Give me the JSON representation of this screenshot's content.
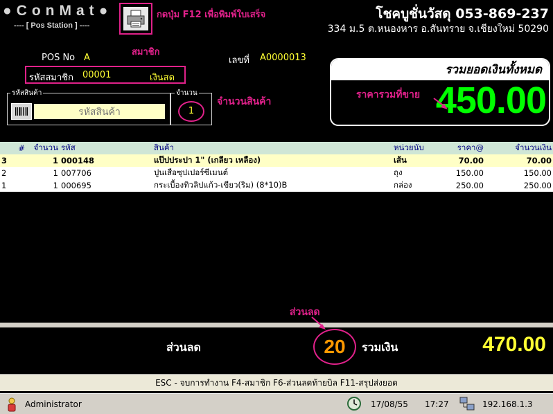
{
  "header": {
    "brand": "ConMat",
    "station": "---- [ Pos Station ] ----",
    "print_hint": "กดปุ่ม F12 เพื่อพิมพ์ใบเสร็จ",
    "shop_name": "โชคบูชั่นวัสดุ 053-869-237",
    "shop_address": "334 ม.5 ต.หนองหาร อ.สันทราย จ.เชียงใหม่ 50290"
  },
  "pos": {
    "pos_no_label": "POS No",
    "pos_no": "A",
    "doc_label": "เลขที่",
    "doc_no": "A0000013"
  },
  "member": {
    "note": "สมาชิก",
    "label": "รหัสสมาชิก",
    "code": "00001",
    "pay_type": "เงินสด"
  },
  "product": {
    "group_label": "รหัสสินค้า",
    "input_placeholder": "รหัสสินค้า",
    "qty_label": "จำนวน",
    "qty_value": "1",
    "qty_note": "จำนวนสินค้า"
  },
  "total": {
    "title": "รวมยอดเงินทั้งหมด",
    "sale_label": "ราคารวมที่ขาย",
    "amount": "450.00"
  },
  "table": {
    "headers": [
      "#",
      "จำนวน",
      "รหัส",
      "สินค้า",
      "หน่วยนับ",
      "ราคา@",
      "จำนวนเงิน"
    ],
    "rows": [
      [
        "3",
        "1",
        "000148",
        "แป๊ปประปา 1\" (เกลียว เหลือง)",
        "เส้น",
        "70.00",
        "70.00"
      ],
      [
        "2",
        "1",
        "007706",
        "ปูนเสือซุปเปอร์ซีเมนต์",
        "ถุง",
        "150.00",
        "150.00"
      ],
      [
        "1",
        "1",
        "000695",
        "กระเบื้องทิวลิปแก้ว-เขียว(ริม) (8*10)B",
        "กล่อง",
        "250.00",
        "250.00"
      ]
    ]
  },
  "summary": {
    "discount_note": "ส่วนลด",
    "discount_label": "ส่วนลด",
    "discount_value": "20",
    "sum_label": "รวมเงิน",
    "sum_value": "470.00"
  },
  "shortcuts": "ESC - จบการทำงาน   F4-สมาชิก   F6-ส่วนลดท้ายบิล   F11-สรุปส่งยอด",
  "status": {
    "user": "Administrator",
    "date": "17/08/55",
    "time": "17:27",
    "ip": "192.168.1.3"
  },
  "colors": {
    "highlight": "#e0218a",
    "total_green": "#00ff00",
    "sum_yellow": "#ffff33",
    "discount_orange": "#ff9900"
  },
  "icons": [
    "printer-icon",
    "barcode-icon",
    "user-icon",
    "clock-icon",
    "network-icon"
  ]
}
